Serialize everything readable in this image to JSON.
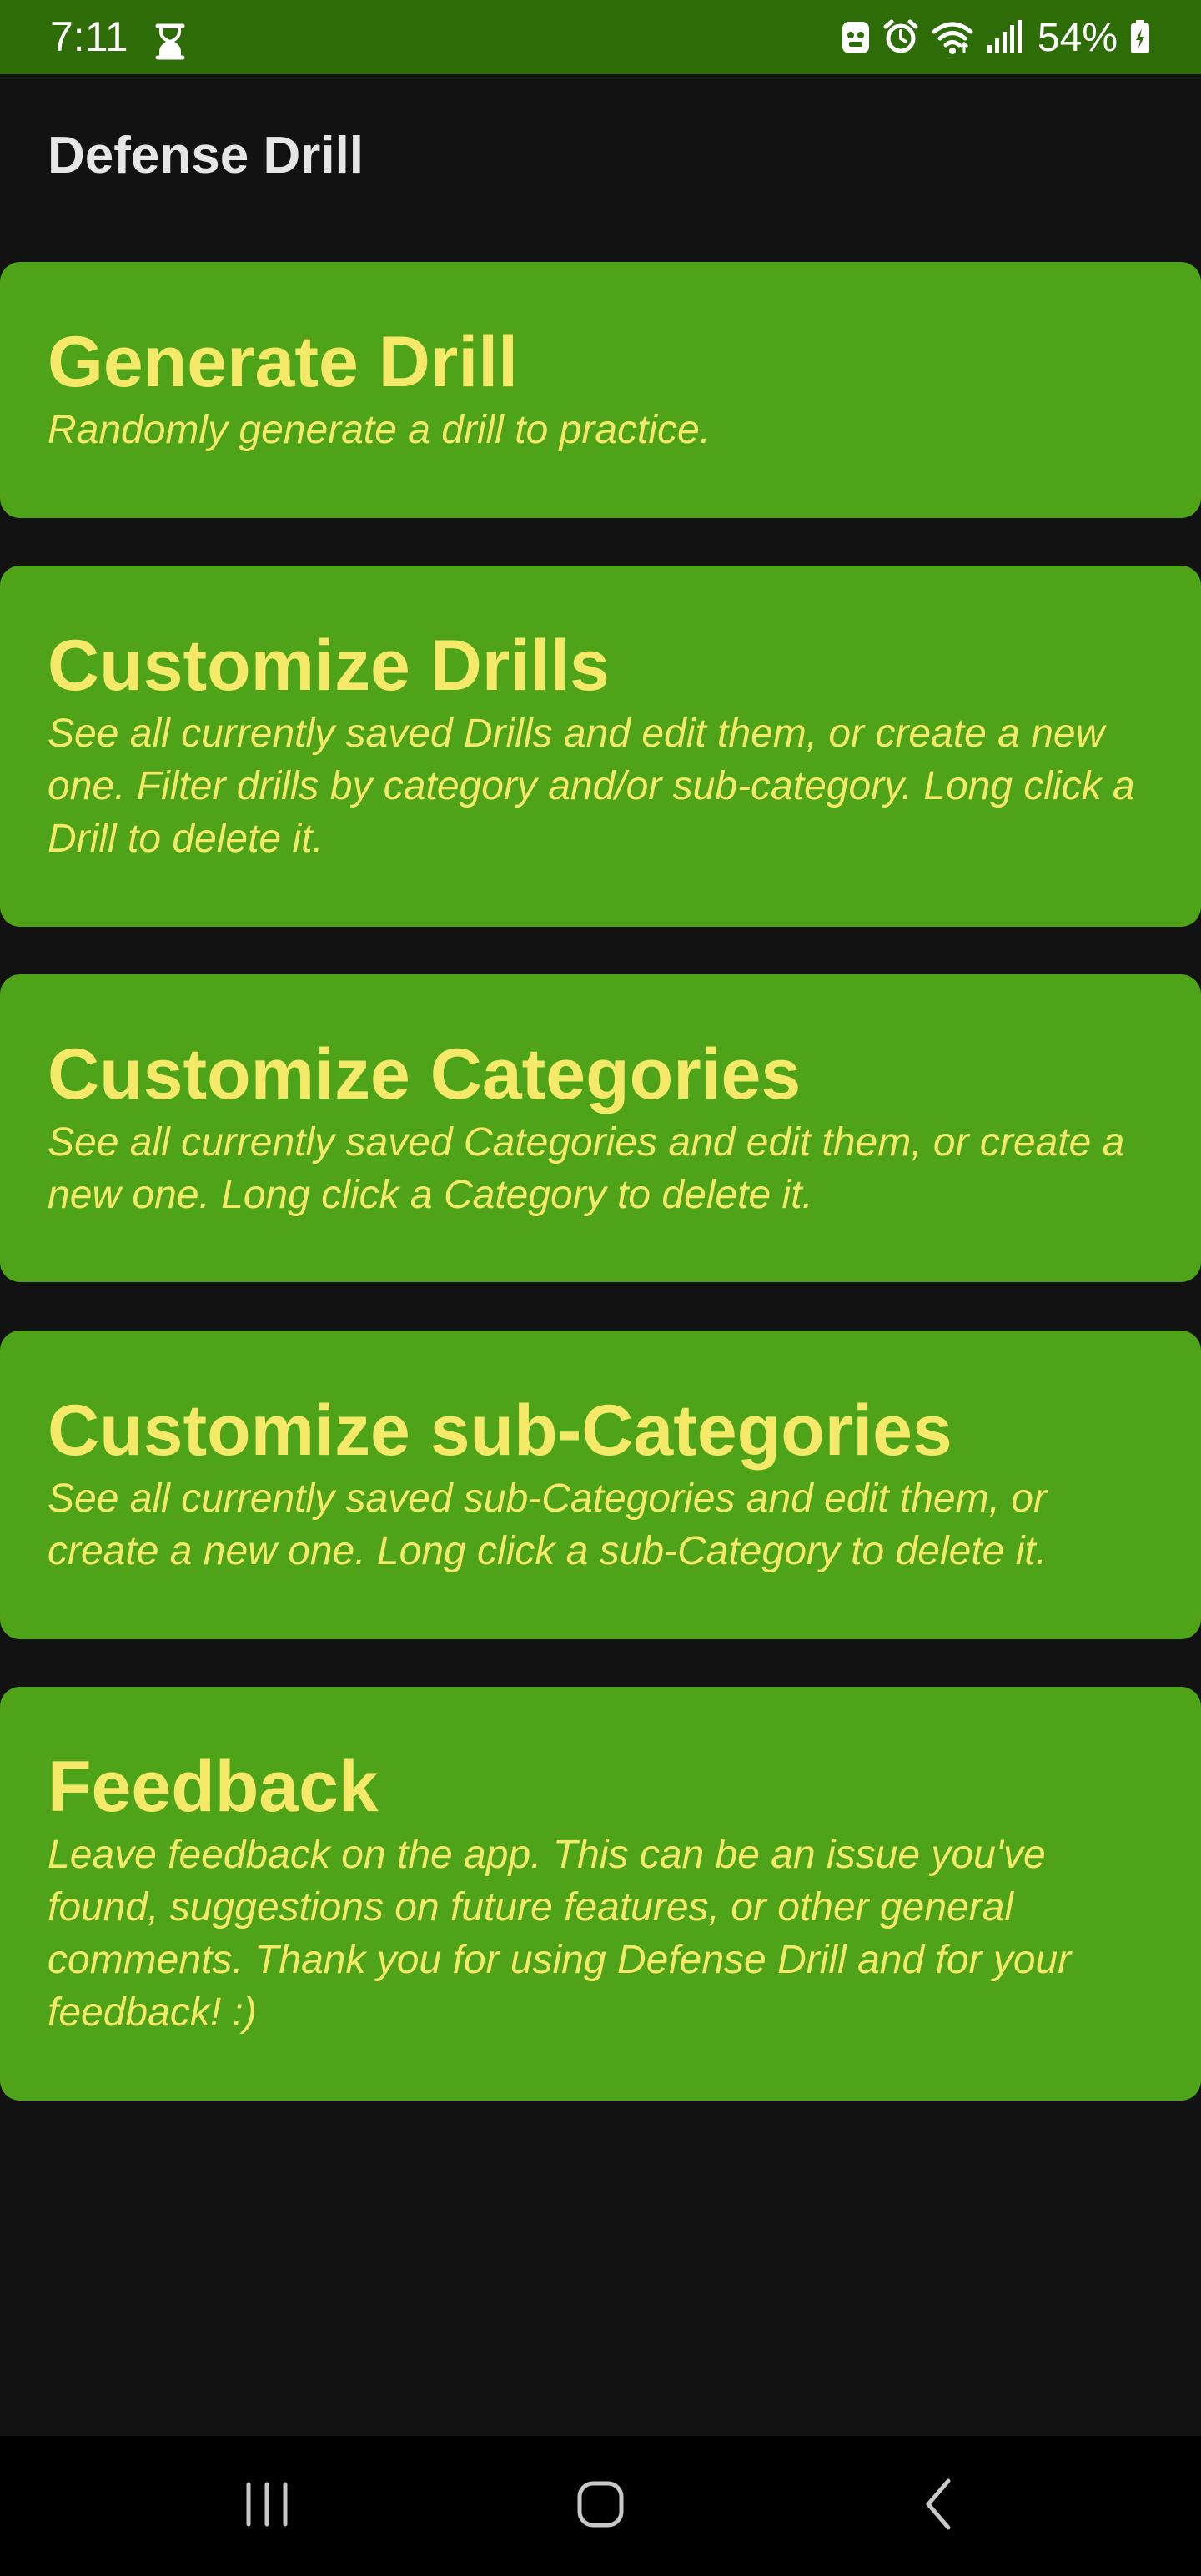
{
  "status_bar": {
    "time": "7:11",
    "battery_percent": "54%",
    "left_icons": [
      "hourglass-icon"
    ],
    "right_icons": [
      "app-notification-icon",
      "alarm-icon",
      "wifi-icon",
      "signal-icon",
      "battery-charging-icon"
    ],
    "background_color": "#2e6c07"
  },
  "app_bar": {
    "title": "Defense Drill"
  },
  "menu": {
    "items": [
      {
        "title": "Generate Drill",
        "description": "Randomly generate a drill to practice."
      },
      {
        "title": "Customize Drills",
        "description": "See all currently saved Drills and edit them, or create a new one. Filter drills by category and/or sub-category. Long click a Drill to delete it."
      },
      {
        "title": "Customize Categories",
        "description": "See all currently saved Categories and edit them, or create a new one. Long click a Category to delete it."
      },
      {
        "title": "Customize sub-Categories",
        "description": "See all currently saved sub-Categories and edit them, or create a new one. Long click a sub-Category to delete it."
      },
      {
        "title": "Feedback",
        "description": "Leave feedback on the app. This can be an issue you've found, suggestions on future features, or other general comments. Thank you for using Defense Drill and for your feedback! :)"
      }
    ]
  },
  "nav_bar": {
    "buttons": [
      "recent-apps-icon",
      "home-icon",
      "back-icon"
    ]
  },
  "colors": {
    "background": "#121212",
    "card": "#4fa318",
    "card_text": "#f5e96a",
    "title_text": "#e6e6e6"
  }
}
